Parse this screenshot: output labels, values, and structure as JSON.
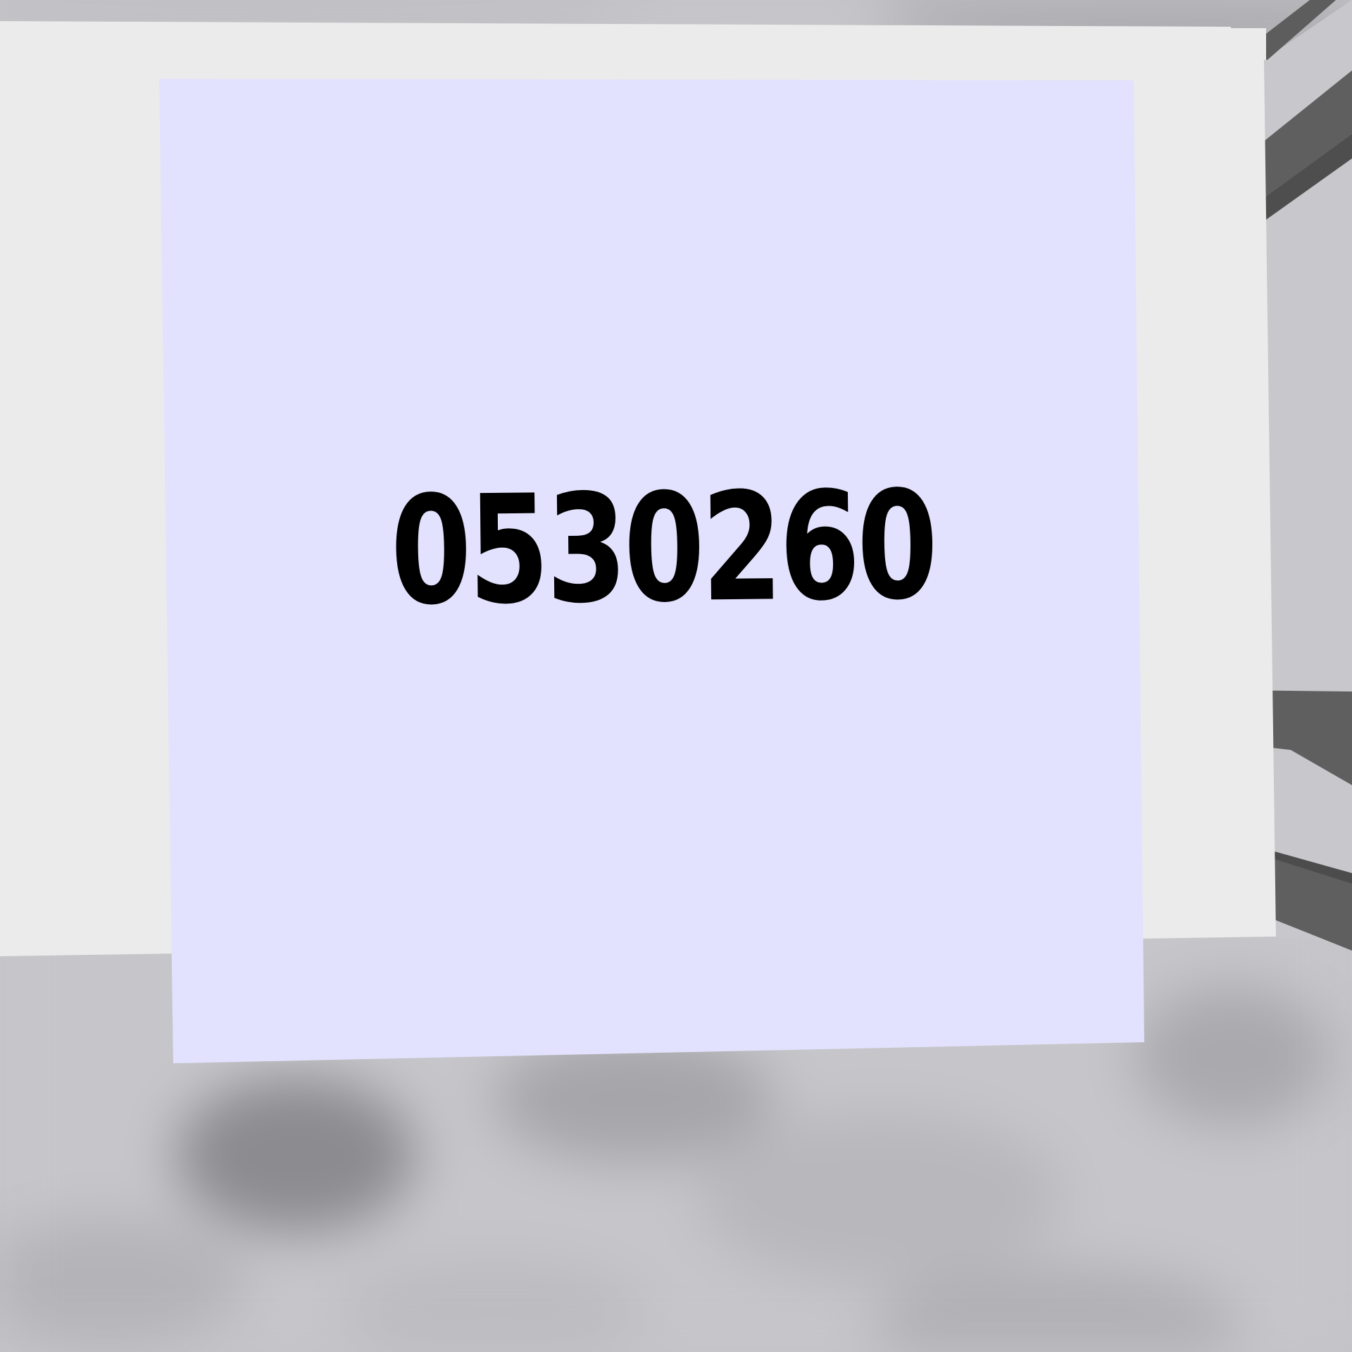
{
  "note": {
    "code": "0530260"
  },
  "colors": {
    "floor": "#c4c4c8",
    "wall": "#ebebeb",
    "note_paper": "#e2e2fe",
    "ink": "#000000",
    "bracket": "#5f5f5f",
    "bracket_side": "#c8c8cc"
  }
}
